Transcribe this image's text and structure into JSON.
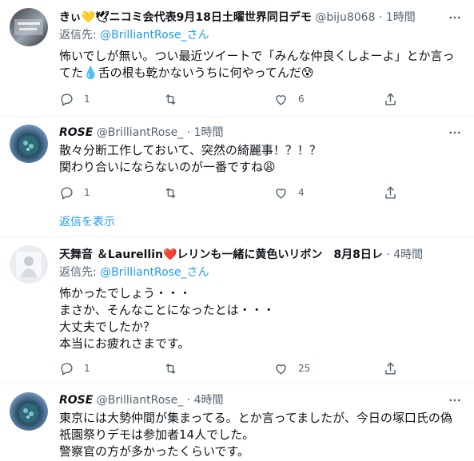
{
  "tweets": [
    {
      "name": "きぃ💛🕊ニコミ会代表9月18日土曜世界同日デモ",
      "handle": "@biju8068",
      "time": "1時間",
      "reply_prefix": "返信先: ",
      "reply_to": "@BrilliantRose_さん",
      "lines": [
        "怖いでしが無い。つい最近ツイートで「みんな仲良くしよーよ」とか言っ",
        "てた💧舌の根も乾かないうちに何やってんだ😰"
      ],
      "replies": "1",
      "retweets": "",
      "likes": "6"
    },
    {
      "name": "ROSE",
      "handle": "@BrilliantRose_",
      "time": "1時間",
      "lines": [
        "散々分断工作しておいて、突然の綺麗事！？！？",
        "関わり合いにならないのが一番ですね😩"
      ],
      "replies": "1",
      "retweets": "",
      "likes": "4"
    },
    {
      "name": "天舞音 ＆Laurellin❤️レリンも一緒に黄色いリボン　8月8日レ",
      "handle": "",
      "time": "4時間",
      "reply_prefix": "返信先: ",
      "reply_to": "@BrilliantRose_さん",
      "lines": [
        "怖かったでしょう・・・",
        "まさか、そんなことになったとは・・・",
        "大丈夫でしたか？",
        "本当にお疲れさまです。"
      ],
      "replies": "1",
      "retweets": "",
      "likes": "25"
    },
    {
      "name": "ROSE",
      "handle": "@BrilliantRose_",
      "time": "4時間",
      "lines": [
        "東京には大勢仲間が集まってる。とか言ってましたが、今日の塚口氏の偽",
        "祇園祭りデモは参加者14人でした。",
        "警察官の方が多かったくらいです。"
      ]
    }
  ],
  "show_replies": "返信を表示",
  "dot": "·",
  "colors": {
    "link": "#1d9bf0",
    "muted": "#536471",
    "text": "#0f1419",
    "divider": "#eff3f4"
  },
  "icons": [
    "reply-icon",
    "retweet-icon",
    "like-icon",
    "share-icon",
    "more-icon"
  ]
}
